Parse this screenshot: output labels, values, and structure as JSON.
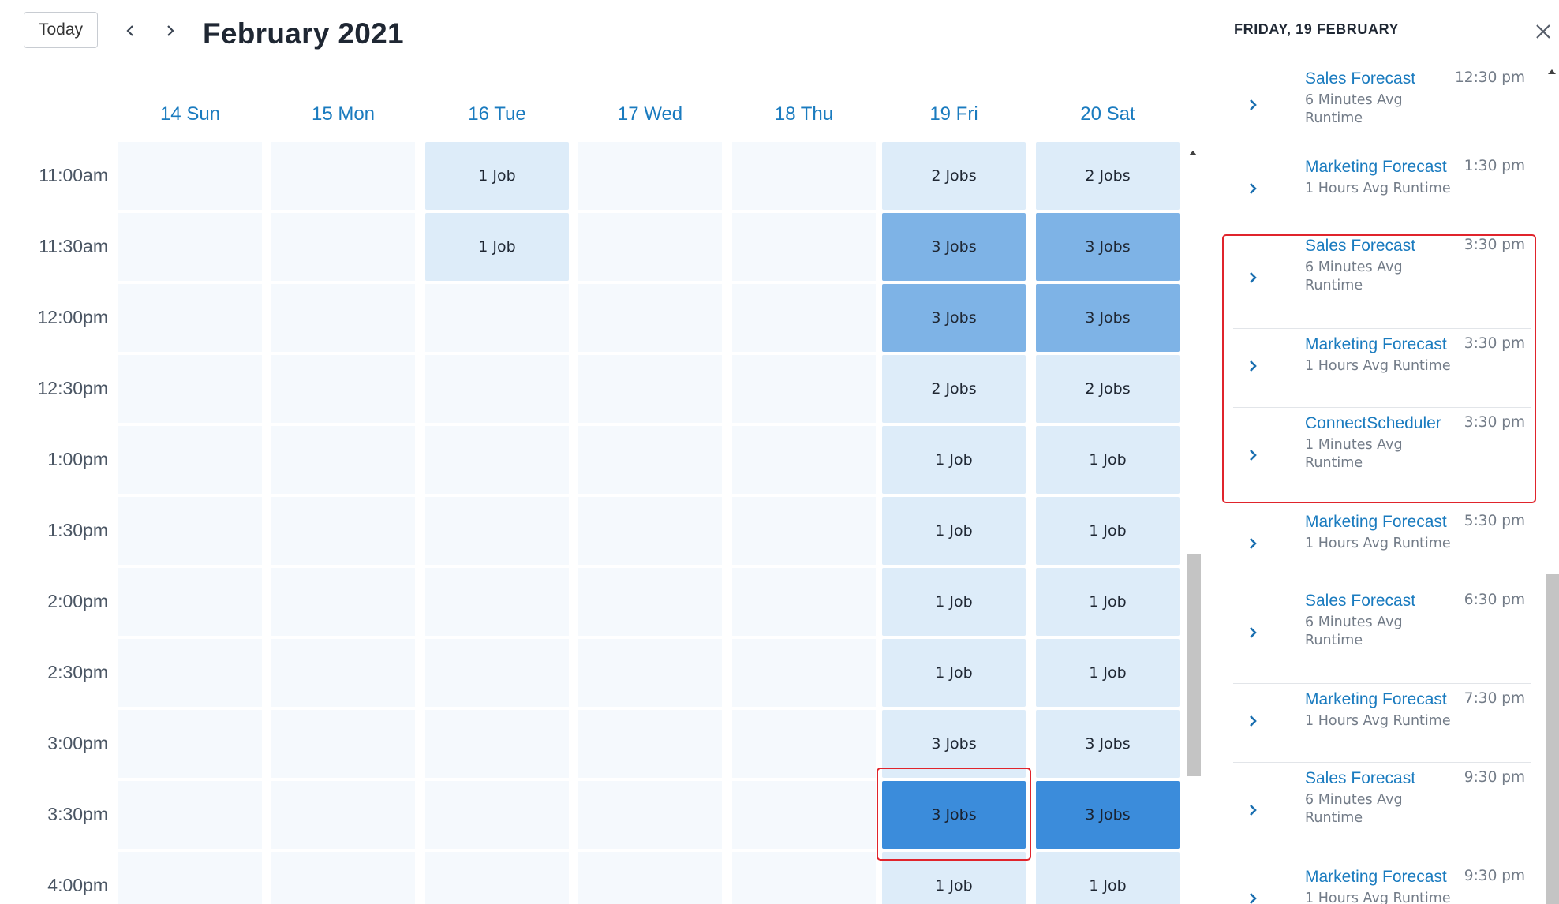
{
  "toolbar": {
    "today_label": "Today",
    "month_title": "February 2021"
  },
  "days": [
    "14 Sun",
    "15 Mon",
    "16 Tue",
    "17 Wed",
    "18 Thu",
    "19 Fri",
    "20 Sat"
  ],
  "time_slots": [
    "11:00am",
    "11:30am",
    "12:00pm",
    "12:30pm",
    "1:00pm",
    "1:30pm",
    "2:00pm",
    "2:30pm",
    "3:00pm",
    "3:30pm",
    "4:00pm"
  ],
  "grid": [
    [
      "",
      "",
      "1 Job",
      "",
      "",
      "2 Jobs",
      "2 Jobs"
    ],
    [
      "",
      "",
      "1 Job",
      "",
      "",
      "3 Jobs",
      "3 Jobs"
    ],
    [
      "",
      "",
      "",
      "",
      "",
      "3 Jobs",
      "3 Jobs"
    ],
    [
      "",
      "",
      "",
      "",
      "",
      "2 Jobs",
      "2 Jobs"
    ],
    [
      "",
      "",
      "",
      "",
      "",
      "1 Job",
      "1 Job"
    ],
    [
      "",
      "",
      "",
      "",
      "",
      "1 Job",
      "1 Job"
    ],
    [
      "",
      "",
      "",
      "",
      "",
      "1 Job",
      "1 Job"
    ],
    [
      "",
      "",
      "",
      "",
      "",
      "1 Job",
      "1 Job"
    ],
    [
      "",
      "",
      "",
      "",
      "",
      "3 Jobs",
      "3 Jobs"
    ],
    [
      "",
      "",
      "",
      "",
      "",
      "3 Jobs",
      "3 Jobs"
    ],
    [
      "",
      "",
      "",
      "",
      "",
      "1 Job",
      "1 Job"
    ]
  ],
  "grid_shade": [
    [
      "e",
      "e",
      "l",
      "e",
      "e",
      "l",
      "l"
    ],
    [
      "e",
      "e",
      "l",
      "e",
      "e",
      "m",
      "m"
    ],
    [
      "e",
      "e",
      "e",
      "e",
      "e",
      "m",
      "m"
    ],
    [
      "e",
      "e",
      "e",
      "e",
      "e",
      "l",
      "l"
    ],
    [
      "e",
      "e",
      "e",
      "e",
      "e",
      "l",
      "l"
    ],
    [
      "e",
      "e",
      "e",
      "e",
      "e",
      "l",
      "l"
    ],
    [
      "e",
      "e",
      "e",
      "e",
      "e",
      "l",
      "l"
    ],
    [
      "e",
      "e",
      "e",
      "e",
      "e",
      "l",
      "l"
    ],
    [
      "e",
      "e",
      "e",
      "e",
      "e",
      "l",
      "l"
    ],
    [
      "e",
      "e",
      "e",
      "e",
      "e",
      "h",
      "h"
    ],
    [
      "e",
      "e",
      "e",
      "e",
      "e",
      "l",
      "l"
    ]
  ],
  "shade_colors": {
    "empty": "#f5f9fd",
    "light": "#ddecf9",
    "medium": "#7eb3e6",
    "heavy": "#3b8cdb",
    "highlight": "#e0242c",
    "accent": "#1a7bbf"
  },
  "panel": {
    "title": "FRIDAY, 19 FEBRUARY",
    "jobs": [
      {
        "name": "Sales Forecast",
        "runtime": "6 Minutes Avg Runtime",
        "time": "12:30 pm"
      },
      {
        "name": "Marketing Forecast",
        "runtime": "1 Hours Avg Runtime",
        "time": "1:30 pm"
      },
      {
        "name": "Sales Forecast",
        "runtime": "6 Minutes Avg Runtime",
        "time": "3:30 pm"
      },
      {
        "name": "Marketing Forecast",
        "runtime": "1 Hours Avg Runtime",
        "time": "3:30 pm"
      },
      {
        "name": "ConnectScheduler",
        "runtime": "1 Minutes Avg Runtime",
        "time": "3:30 pm"
      },
      {
        "name": "Marketing Forecast",
        "runtime": "1 Hours Avg Runtime",
        "time": "5:30 pm"
      },
      {
        "name": "Sales Forecast",
        "runtime": "6 Minutes Avg Runtime",
        "time": "6:30 pm"
      },
      {
        "name": "Marketing Forecast",
        "runtime": "1 Hours Avg Runtime",
        "time": "7:30 pm"
      },
      {
        "name": "Sales Forecast",
        "runtime": "6 Minutes Avg Runtime",
        "time": "9:30 pm"
      },
      {
        "name": "Marketing Forecast",
        "runtime": "1 Hours Avg Runtime",
        "time": "9:30 pm"
      }
    ]
  },
  "icons": {
    "prev": "chevron-left-icon",
    "next": "chevron-right-icon",
    "close": "close-icon",
    "expand": "chevron-right-icon"
  }
}
